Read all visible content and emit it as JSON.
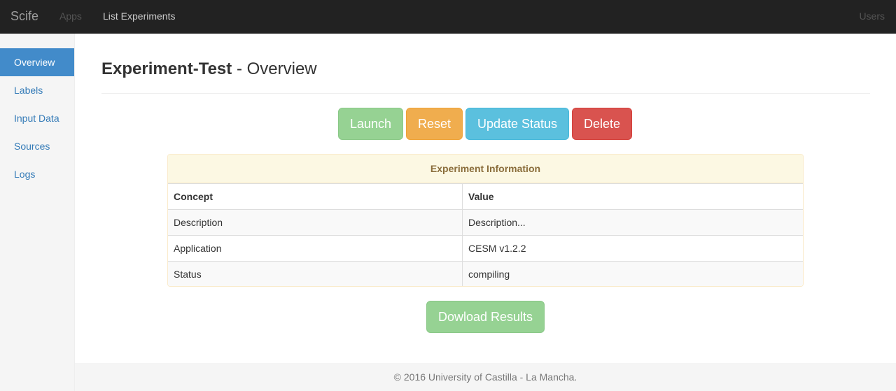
{
  "navbar": {
    "brand": "Scife",
    "apps_label": "Apps",
    "list_experiments_label": "List Experiments",
    "users_label": "Users"
  },
  "sidebar": {
    "items": [
      {
        "label": "Overview",
        "active": true
      },
      {
        "label": "Labels"
      },
      {
        "label": "Input Data"
      },
      {
        "label": "Sources"
      },
      {
        "label": "Logs"
      }
    ]
  },
  "header": {
    "experiment_name": "Experiment-Test",
    "section": " - Overview"
  },
  "actions": {
    "launch": "Launch",
    "reset": "Reset",
    "update_status": "Update Status",
    "delete": "Delete",
    "download": "Dowload Results"
  },
  "info_panel": {
    "title": "Experiment Information",
    "columns": [
      "Concept",
      "Value"
    ],
    "rows": [
      {
        "concept": "Description",
        "value": "Description..."
      },
      {
        "concept": "Application",
        "value": "CESM v1.2.2"
      },
      {
        "concept": "Status",
        "value": "compiling"
      }
    ]
  },
  "footer": {
    "text": "© 2016 University of Castilla - La Mancha."
  },
  "colors": {
    "navbar_bg": "#222222",
    "active_sidebar": "#428bca",
    "launch": "#96d293",
    "reset": "#f0ad4e",
    "update_status": "#5bc0de",
    "delete": "#d9534f",
    "panel_heading_bg": "#fcf8e3"
  }
}
